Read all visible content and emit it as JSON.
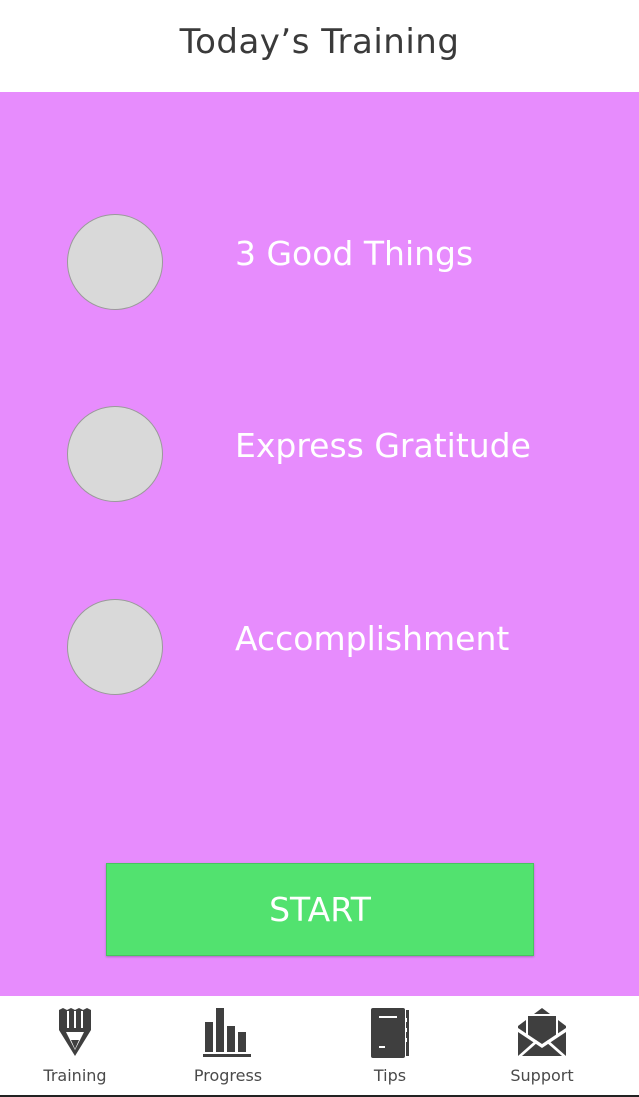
{
  "header": {
    "title": "Today’s Training"
  },
  "tasks": [
    {
      "label": "3 Good Things",
      "completed": false
    },
    {
      "label": "Express Gratitude",
      "completed": false
    },
    {
      "label": "Accomplishment",
      "completed": false
    }
  ],
  "start_button": {
    "label": "START"
  },
  "tabbar": {
    "tabs": [
      {
        "label": "Training",
        "icon": "pencil-icon"
      },
      {
        "label": "Progress",
        "icon": "bar-chart-icon"
      },
      {
        "label": "Tips",
        "icon": "notebook-icon"
      },
      {
        "label": "Support",
        "icon": "envelope-icon"
      }
    ]
  },
  "colors": {
    "background": "#e78cfd",
    "start_button": "#52e26f",
    "checkbox": "#d9d9d9"
  }
}
